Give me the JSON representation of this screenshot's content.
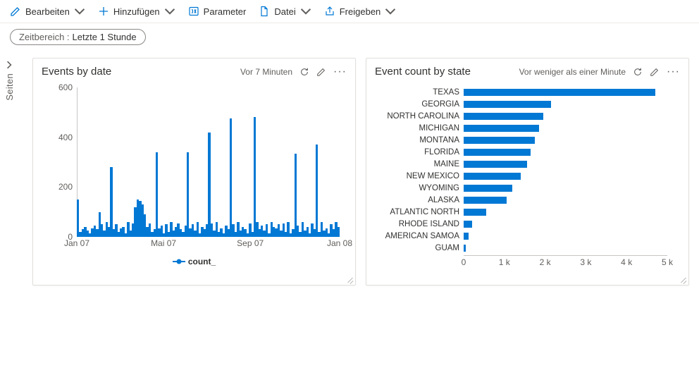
{
  "toolbar": {
    "edit": "Bearbeiten",
    "add": "Hinzufügen",
    "param": "Parameter",
    "file": "Datei",
    "share": "Freigeben"
  },
  "filter": {
    "label": "Zeitbereich :",
    "value": "Letzte 1 Stunde"
  },
  "side": {
    "label": "Seiten"
  },
  "card1": {
    "title": "Events by date",
    "timestamp": "Vor 7 Minuten",
    "legend": "count_",
    "yticks": [
      "0",
      "200",
      "400",
      "600"
    ],
    "xticks": [
      "Jan 07",
      "Mai 07",
      "Sep 07",
      "Jan 08"
    ]
  },
  "card2": {
    "title": "Event count by state",
    "timestamp": "Vor weniger als einer Minute",
    "xticks": [
      "0",
      "1 k",
      "2 k",
      "3 k",
      "4 k",
      "5 k"
    ]
  },
  "chart_data": [
    {
      "type": "bar",
      "title": "Events by date",
      "xlabel": "",
      "ylabel": "",
      "ylim": [
        0,
        600
      ],
      "x_range": [
        "2007-01",
        "2008-01"
      ],
      "legend": "count_",
      "values": [
        150,
        20,
        30,
        40,
        25,
        15,
        35,
        45,
        30,
        100,
        50,
        25,
        60,
        40,
        280,
        30,
        50,
        20,
        35,
        40,
        15,
        60,
        25,
        55,
        120,
        150,
        145,
        130,
        90,
        40,
        55,
        20,
        30,
        340,
        35,
        45,
        15,
        50,
        20,
        60,
        25,
        40,
        55,
        30,
        20,
        45,
        340,
        35,
        50,
        25,
        60,
        15,
        40,
        30,
        50,
        420,
        55,
        25,
        60,
        20,
        35,
        15,
        45,
        30,
        475,
        50,
        20,
        60,
        25,
        40,
        30,
        15,
        55,
        20,
        480,
        60,
        30,
        45,
        25,
        50,
        15,
        60,
        40,
        35,
        50,
        25,
        55,
        20,
        60,
        15,
        30,
        335,
        45,
        20,
        60,
        25,
        40,
        15,
        55,
        30,
        370,
        20,
        60,
        25,
        35,
        15,
        50,
        30,
        60,
        40
      ]
    },
    {
      "type": "bar",
      "orientation": "horizontal",
      "title": "Event count by state",
      "xlabel": "",
      "ylabel": "",
      "xlim": [
        0,
        5000
      ],
      "categories": [
        "TEXAS",
        "GEORGIA",
        "NORTH CAROLINA",
        "MICHIGAN",
        "MONTANA",
        "FLORIDA",
        "MAINE",
        "NEW MEXICO",
        "WYOMING",
        "ALASKA",
        "ATLANTIC NORTH",
        "RHODE ISLAND",
        "AMERICAN SAMOA",
        "GUAM"
      ],
      "values": [
        4700,
        2150,
        1950,
        1850,
        1750,
        1650,
        1550,
        1400,
        1200,
        1050,
        550,
        200,
        120,
        60
      ]
    }
  ]
}
